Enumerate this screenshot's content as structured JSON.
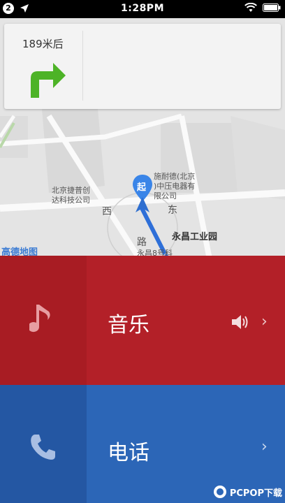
{
  "status_bar": {
    "notification_count": "2",
    "time": "1:28PM"
  },
  "navigation": {
    "distance": "189米后",
    "maneuver": "turn-right-icon"
  },
  "map": {
    "labels": {
      "poi_west": "北京捷普创\n达科技公司",
      "poi_east": "施耐德(北京\n)中压电器有\n限公司",
      "road_west": "西",
      "road_east": "东",
      "road_south": "路",
      "industrial_park": "永昌工业园",
      "street_address": "永昌8号科",
      "start_marker": "起",
      "brand": "高德地图"
    }
  },
  "music": {
    "title": "音乐",
    "accent_color": "#b32028"
  },
  "phone": {
    "title": "电话",
    "accent_color": "#2c66b7"
  },
  "watermark": {
    "text": "PCPOP下载"
  }
}
